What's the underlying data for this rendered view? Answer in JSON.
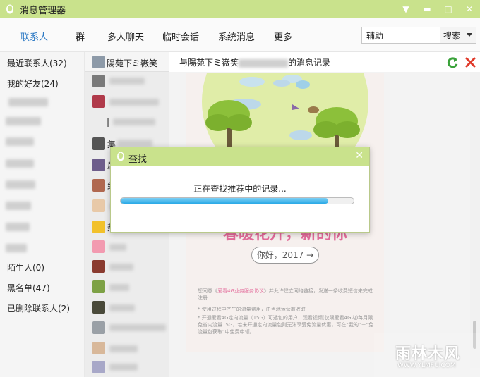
{
  "window": {
    "title": "消息管理器",
    "buttons": [
      "▼",
      "▬",
      "□",
      "✕"
    ]
  },
  "tabs": [
    {
      "label": "联系人",
      "active": true
    },
    {
      "label": "群"
    },
    {
      "label": "多人聊天"
    },
    {
      "label": "临时会话"
    },
    {
      "label": "系统消息"
    },
    {
      "label": "更多"
    }
  ],
  "search": {
    "value": "辅助",
    "button_label": "搜索"
  },
  "categories": [
    {
      "label": "最近联系人(32)"
    },
    {
      "label": "我的好友(24)"
    },
    {
      "label": "陌生人(0)"
    },
    {
      "label": "黑名单(47)"
    },
    {
      "label": "已删除联系人(2)"
    }
  ],
  "contact_list": {
    "selected_name": "陽苑下ミ嶶笑",
    "visible_fragments": [
      "|",
      "集",
      "后",
      "绿",
      "热"
    ]
  },
  "message_header": {
    "title_prefix": "与陽苑下ミ嶶笑",
    "title_suffix": "的消息记录"
  },
  "card": {
    "headline": "春暖花开，新的你",
    "pill_label": "你好，2017 →",
    "fine_print_1a": "您同意《",
    "fine_print_1b": "爱看4G业务服务协议",
    "fine_print_1c": "》并允许建立网络链接，发送一条收费短信来完成注册",
    "fine_print_2": "* 使用过程中产生的流量费用，由当地运营商收取",
    "fine_print_3": "* 开通爱看4G定向流量（15G）可选包的用户，观看视频(仅限爱看4G内)每月限免省内流量15G，若未开通定向流量包则无法享受免流量优惠，可在“我的”－“免流量包获取”中免费申领。"
  },
  "dialog": {
    "title": "查找",
    "message": "正在查找推荐中的记录...",
    "progress": 0.89
  },
  "watermark": {
    "text": "雨林木风",
    "url": "WWW.YLMFU.COM"
  },
  "colors": {
    "titlebar": "#c9e28c",
    "active_tab": "#2a78c4",
    "accent_pink": "#e36b9a",
    "progress": "#29a9e6"
  }
}
